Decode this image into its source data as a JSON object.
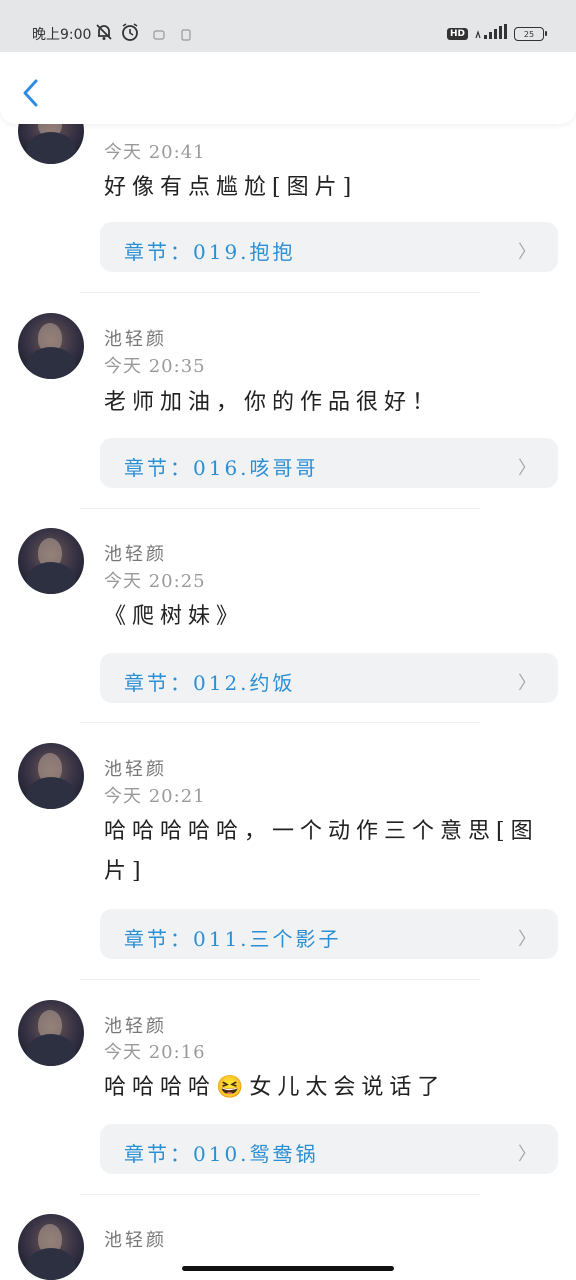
{
  "status_bar": {
    "time_label": "晚上9:00",
    "network_type": "HD",
    "battery_level": "25",
    "icons": [
      "mute-bell-icon",
      "alarm-icon",
      "app-icon",
      "app-icon",
      "signal-icon",
      "battery-icon"
    ]
  },
  "header": {
    "back_icon": "chevron-left-icon"
  },
  "comments": [
    {
      "username": "",
      "time": "今天 20:41",
      "text": "好像有点尴尬[图片]",
      "chapter": "章节：019.抱抱"
    },
    {
      "username": "池轻颜",
      "time": "今天 20:35",
      "text": "老师加油，你的作品很好！",
      "chapter": "章节：016.咳哥哥"
    },
    {
      "username": "池轻颜",
      "time": "今天 20:25",
      "text": "《爬树妹》",
      "chapter": "章节：012.约饭"
    },
    {
      "username": "池轻颜",
      "time": "今天 20:21",
      "text": "哈哈哈哈哈，一个动作三个意思[图片]",
      "chapter": "章节：011.三个影子"
    },
    {
      "username": "池轻颜",
      "time": "今天 20:16",
      "text": "哈哈哈哈😆女儿太会说话了",
      "chapter": "章节：010.鸳鸯锅"
    },
    {
      "username": "池轻颜",
      "time": "",
      "text": "",
      "chapter": ""
    }
  ],
  "colors": {
    "chapter_text": "#2b8fd6",
    "chapter_bg": "#f1f2f3",
    "back_icon": "#2f8de4",
    "status_bg": "#e5e6e8"
  }
}
